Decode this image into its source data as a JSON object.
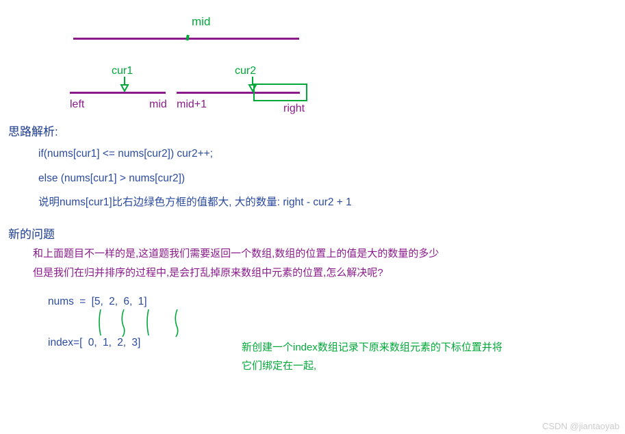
{
  "diagram": {
    "top": {
      "mid_label": "mid"
    },
    "pointers": {
      "cur1": "cur1",
      "cur2": "cur2"
    },
    "segments": {
      "left": "left",
      "mid": "mid",
      "mid_plus_1": "mid+1",
      "right": "right"
    }
  },
  "sections": {
    "analysis_title": "思路解析:",
    "code_line1": "if(nums[cur1] <= nums[cur2]) cur2++;",
    "code_line2": "else (nums[cur1] > nums[cur2])",
    "explain_line": "说明nums[cur1]比右边绿色方框的值都大, 大的数量: right - cur2 + 1",
    "new_problem_title": "新的问题",
    "new_problem_line1": "和上面题目不一样的是,这道题我们需要返回一个数组,数组的位置上的值是大的数量的多少",
    "new_problem_line2": "但是我们在归并排序的过程中,是会打乱掉原来数组中元素的位置,怎么解决呢?"
  },
  "arrays": {
    "nums_label": "nums = ",
    "nums_display": "[5,    2,    6,    1]",
    "index_label": "index=",
    "index_display": "[ 0,    1,    2,    3]"
  },
  "bottom_note": "新创建一个index数组记录下原来数组元素的下标位置并将它们绑定在一起,",
  "watermark": "CSDN @jiantaoyab",
  "chart_data": {
    "type": "table",
    "title": "Merge sort reverse-pair counting illustration",
    "segments": [
      {
        "name": "left..mid",
        "pointer": "cur1"
      },
      {
        "name": "mid+1..right",
        "pointer": "cur2"
      }
    ],
    "rule": "when nums[cur1] > nums[cur2], count = right - cur2 + 1",
    "nums": [
      5,
      2,
      6,
      1
    ],
    "index": [
      0,
      1,
      2,
      3
    ]
  }
}
